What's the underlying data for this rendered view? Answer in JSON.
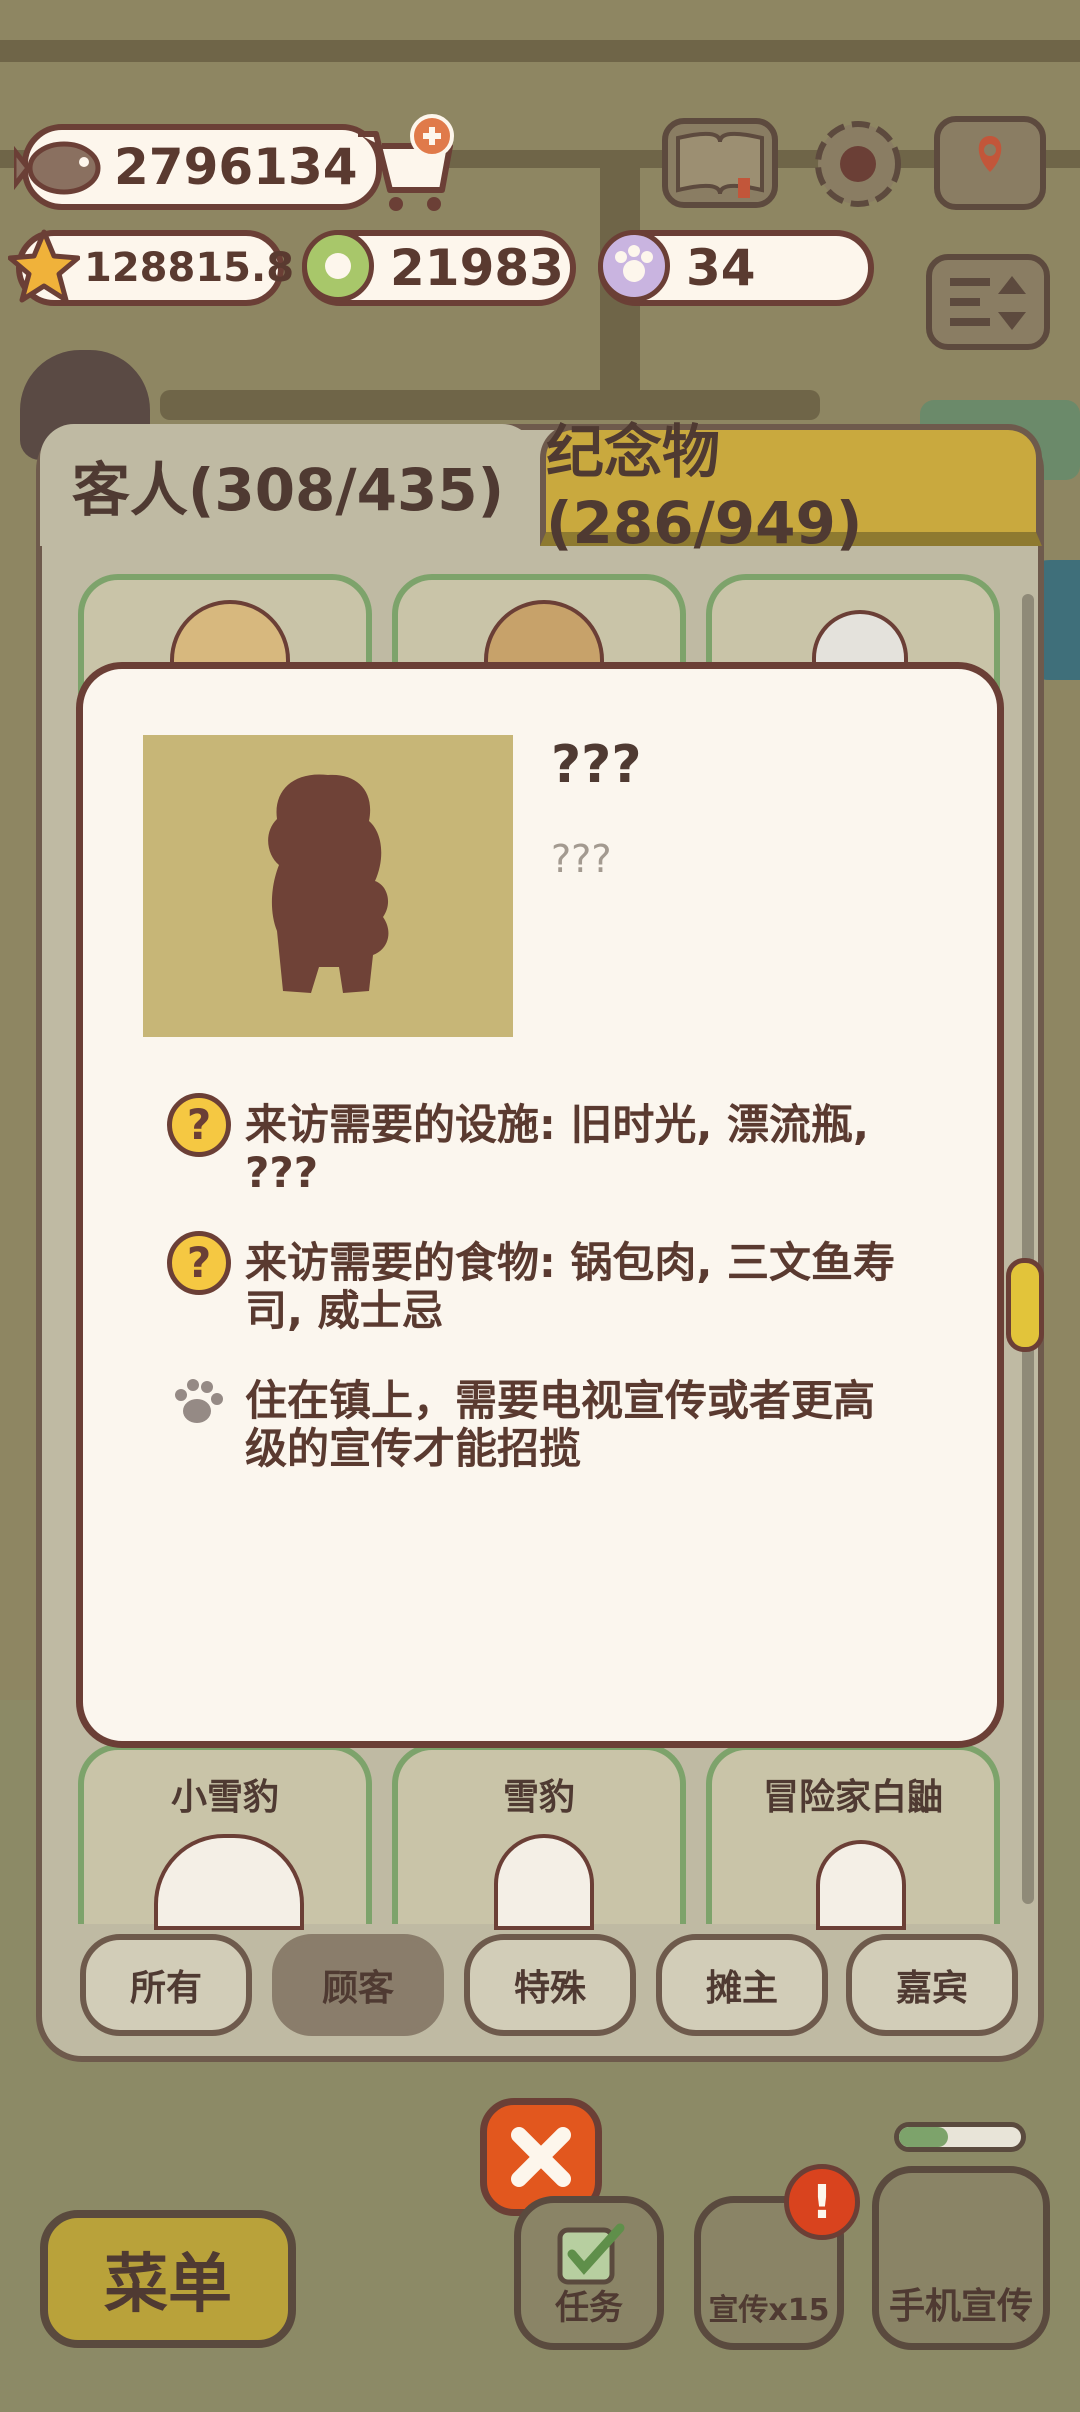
{
  "currency": {
    "fish": "2796134",
    "stars": "128815.8",
    "tokens": "21983",
    "paws": "34"
  },
  "tabs": {
    "guests": "客人(308/435)",
    "souvenirs": "纪念物(286/949)"
  },
  "grid": {
    "bottom_names": [
      "小雪豹",
      "雪豹",
      "冒险家白鼬"
    ]
  },
  "detail": {
    "name": "???",
    "subtitle": "???",
    "facilities_label": "来访需要的设施: 旧时光, 漂流瓶,",
    "facilities_cont": "???",
    "food_label": "来访需要的食物: 锅包肉, 三文鱼寿",
    "food_cont": "司, 威士忌",
    "town_line1": "住在镇上，需要电视宣传或者更高",
    "town_line2": "级的宣传才能招揽"
  },
  "filters": [
    "所有",
    "顾客",
    "特殊",
    "摊主",
    "嘉宾"
  ],
  "active_filter": "顾客",
  "bottom": {
    "menu": "菜单",
    "tasks": "任务",
    "promo": "宣传x15",
    "phone_promo": "手机宣传"
  },
  "colors": {
    "panel": "#bfbaa3",
    "modal": "#fbf6ee",
    "accent_gold": "#c9a93e",
    "outline": "#6b3f36",
    "close_red": "#e2571e"
  },
  "icons": [
    "fish-icon",
    "cart-add-icon",
    "book-icon",
    "gear-icon",
    "map-icon",
    "star-icon",
    "token-icon",
    "paw-icon",
    "sort-icon",
    "question-icon",
    "paw-print-icon",
    "close-icon"
  ]
}
